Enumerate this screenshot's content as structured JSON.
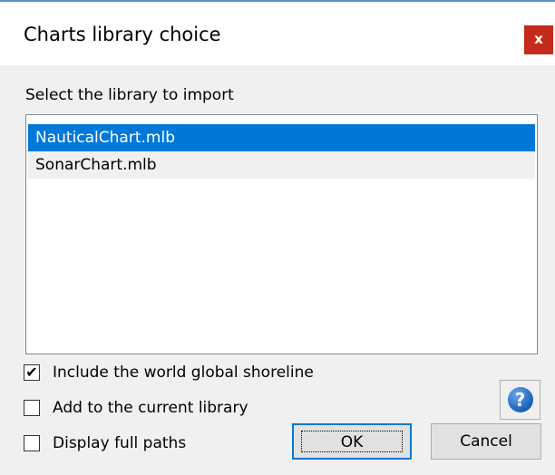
{
  "dialog": {
    "title": "Charts library choice",
    "close_label": "x",
    "instruction": "Select the library to import",
    "libraries": [
      {
        "label": "NauticalChart.mlb",
        "selected": true
      },
      {
        "label": "SonarChart.mlb",
        "selected": false
      }
    ],
    "options": {
      "include_shoreline": {
        "label": "Include the world global shoreline",
        "checked": true
      },
      "add_current": {
        "label": "Add to the current library",
        "checked": false
      },
      "full_paths": {
        "label": "Display full paths",
        "checked": false
      }
    },
    "help_label": "?",
    "ok_label": "OK",
    "cancel_label": "Cancel"
  },
  "colors": {
    "selection": "#0078d7",
    "close": "#c42b1c",
    "accent_border": "#5b8fd0"
  }
}
